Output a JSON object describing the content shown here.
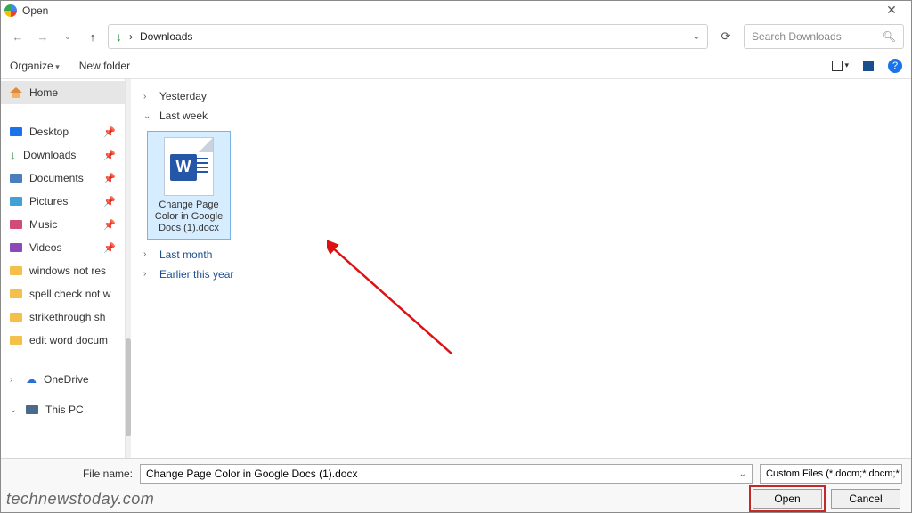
{
  "window": {
    "title": "Open"
  },
  "nav": {
    "location": "Downloads",
    "separator": "›"
  },
  "search": {
    "placeholder": "Search Downloads"
  },
  "toolbar": {
    "organize": "Organize",
    "newfolder": "New folder",
    "view_drop": "▾",
    "help": "?"
  },
  "sidebar": {
    "home": "Home",
    "quick": [
      {
        "label": "Desktop"
      },
      {
        "label": "Downloads"
      },
      {
        "label": "Documents"
      },
      {
        "label": "Pictures"
      },
      {
        "label": "Music"
      },
      {
        "label": "Videos"
      },
      {
        "label": "windows not res"
      },
      {
        "label": "spell check not w"
      },
      {
        "label": "strikethrough sh"
      },
      {
        "label": "edit word docum"
      }
    ],
    "onedrive": "OneDrive",
    "thispc": "This PC"
  },
  "groups": {
    "yesterday": "Yesterday",
    "lastweek": "Last week",
    "lastmonth": "Last month",
    "earlier": "Earlier this year"
  },
  "file": {
    "name_lines": "Change Page Color in Google Docs (1).docx"
  },
  "bottom": {
    "filename_label": "File name:",
    "filename_value": "Change Page Color in Google Docs (1).docx",
    "filter_label": "Custom Files (*.docm;*.docm;*",
    "open": "Open",
    "cancel": "Cancel"
  },
  "watermark": "technewstoday.com"
}
